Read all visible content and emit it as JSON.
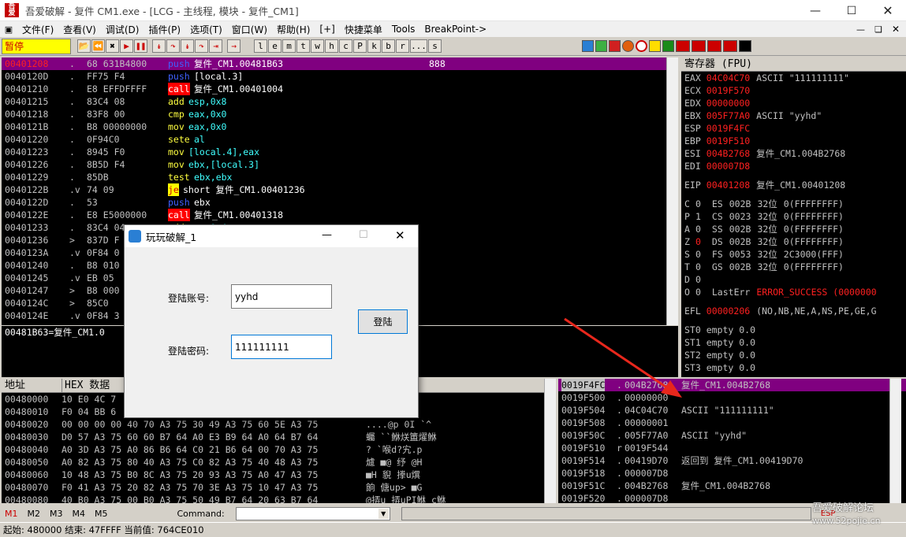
{
  "title": "吾爱破解 - 复件 CM1.exe - [LCG - 主线程, 模块 - 复件_CM1]",
  "menu": [
    "文件(F)",
    "查看(V)",
    "调试(D)",
    "插件(P)",
    "选项(T)",
    "窗口(W)",
    "帮助(H)",
    "[+]",
    "快捷菜单",
    "Tools",
    "BreakPoint->"
  ],
  "state": "暂停",
  "toolbar_letters": [
    "l",
    "e",
    "m",
    "t",
    "w",
    "h",
    "c",
    "P",
    "k",
    "b",
    "r",
    "...",
    "s"
  ],
  "disasm": [
    {
      "addr": "00401208",
      "dot": ".",
      "hex": "68 631B4800",
      "mn": "push",
      "ops": "复件_CM1.00481B63",
      "cmt": "888",
      "sel": true
    },
    {
      "addr": "0040120D",
      "dot": ".",
      "hex": "FF75 F4",
      "mn": "push",
      "ops": "[local.3]"
    },
    {
      "addr": "00401210",
      "dot": ".",
      "hex": "E8 EFFDFFFF",
      "mn": "call",
      "ops": "复件_CM1.00401004"
    },
    {
      "addr": "00401215",
      "dot": ".",
      "hex": "83C4 08",
      "mn": "add",
      "ops": "esp,0x8"
    },
    {
      "addr": "00401218",
      "dot": ".",
      "hex": "83F8 00",
      "mn": "cmp",
      "ops": "eax,0x0"
    },
    {
      "addr": "0040121B",
      "dot": ".",
      "hex": "B8 00000000",
      "mn": "mov",
      "ops": "eax,0x0"
    },
    {
      "addr": "00401220",
      "dot": ".",
      "hex": "0F94C0",
      "mn": "sete",
      "ops": "al"
    },
    {
      "addr": "00401223",
      "dot": ".",
      "hex": "8945 F0",
      "mn": "mov",
      "ops": "[local.4],eax"
    },
    {
      "addr": "00401226",
      "dot": ".",
      "hex": "8B5D F4",
      "mn": "mov",
      "ops": "ebx,[local.3]"
    },
    {
      "addr": "00401229",
      "dot": ".",
      "hex": "85DB",
      "mn": "test",
      "ops": "ebx,ebx"
    },
    {
      "addr": "0040122B",
      "dot": ".v",
      "hex": "74 09",
      "mn": "je",
      "ops": "short 复件_CM1.00401236"
    },
    {
      "addr": "0040122D",
      "dot": ".",
      "hex": "53",
      "mn": "push",
      "ops": "ebx"
    },
    {
      "addr": "0040122E",
      "dot": ".",
      "hex": "E8 E5000000",
      "mn": "call",
      "ops": "复件_CM1.00401318"
    },
    {
      "addr": "00401233",
      "dot": ".",
      "hex": "83C4 04",
      "mn": "add",
      "ops": "esp,0x4"
    },
    {
      "addr": "00401236",
      "dot": ">",
      "hex": "837D F",
      "mn": "",
      "ops": ""
    },
    {
      "addr": "0040123A",
      "dot": ".v",
      "hex": "0F84 0",
      "mn": "",
      "ops": ""
    },
    {
      "addr": "00401240",
      "dot": ".",
      "hex": "B8 010",
      "mn": "",
      "ops": ""
    },
    {
      "addr": "00401245",
      "dot": ".v",
      "hex": "EB 05",
      "mn": "",
      "ops": ""
    },
    {
      "addr": "00401247",
      "dot": ">",
      "hex": "B8 000",
      "mn": "",
      "ops": ""
    },
    {
      "addr": "0040124C",
      "dot": ">",
      "hex": "85C0",
      "mn": "",
      "ops": ""
    },
    {
      "addr": "0040124E",
      "dot": ".v",
      "hex": "0F84 3",
      "mn": "",
      "ops": ""
    }
  ],
  "info_line": "00481B63=复件_CM1.0",
  "registers_title": "寄存器 (FPU)",
  "registers": [
    {
      "n": "EAX",
      "v": "04C04C70",
      "c": "ASCII \"111111111\""
    },
    {
      "n": "ECX",
      "v": "0019F570",
      "c": ""
    },
    {
      "n": "EDX",
      "v": "00000000",
      "c": ""
    },
    {
      "n": "EBX",
      "v": "005F77A0",
      "c": "ASCII \"yyhd\""
    },
    {
      "n": "ESP",
      "v": "0019F4FC",
      "c": ""
    },
    {
      "n": "EBP",
      "v": "0019F510",
      "c": ""
    },
    {
      "n": "ESI",
      "v": "004B2768",
      "c": "复件_CM1.004B2768"
    },
    {
      "n": "EDI",
      "v": "000007D8",
      "c": ""
    }
  ],
  "eip": {
    "n": "EIP",
    "v": "00401208",
    "c": "复件_CM1.00401208"
  },
  "flags": [
    {
      "f": "C",
      "b": "0",
      "seg": "ES",
      "sv": "002B",
      "bits": "32位",
      "rng": "0(FFFFFFFF)"
    },
    {
      "f": "P",
      "b": "1",
      "seg": "CS",
      "sv": "0023",
      "bits": "32位",
      "rng": "0(FFFFFFFF)"
    },
    {
      "f": "A",
      "b": "0",
      "seg": "SS",
      "sv": "002B",
      "bits": "32位",
      "rng": "0(FFFFFFFF)"
    },
    {
      "f": "Z",
      "b": "0",
      "seg": "DS",
      "sv": "002B",
      "bits": "32位",
      "rng": "0(FFFFFFFF)"
    },
    {
      "f": "S",
      "b": "0",
      "seg": "FS",
      "sv": "0053",
      "bits": "32位",
      "rng": "2C3000(FFF)"
    },
    {
      "f": "T",
      "b": "0",
      "seg": "GS",
      "sv": "002B",
      "bits": "32位",
      "rng": "0(FFFFFFFF)"
    },
    {
      "f": "D",
      "b": "0",
      "seg": "",
      "sv": "",
      "bits": "",
      "rng": ""
    },
    {
      "f": "O",
      "b": "0",
      "seg": "LastErr",
      "sv": "ERROR_SUCCESS (0000000",
      "bits": "",
      "rng": ""
    }
  ],
  "efl": {
    "n": "EFL",
    "v": "00000206",
    "c": "(NO,NB,NE,A,NS,PE,GE,G"
  },
  "fpu": [
    "ST0 empty 0.0",
    "ST1 empty 0.0",
    "ST2 empty 0.0",
    "ST3 empty 0.0"
  ],
  "dump_header": {
    "addr": "地址",
    "hex": "HEX 数据"
  },
  "dump": [
    {
      "a": "00480000",
      "h": "10 E0 4C 7",
      "t": "歘?Lv"
    },
    {
      "a": "00480010",
      "h": "F0 04 BB 6",
      "t": "p@■:p"
    },
    {
      "a": "00480020",
      "h": "00 00 00 00 40 70 A3 75 30 49 A3 75 60 5E A3 75",
      "t": "....@p  0I   `^"
    },
    {
      "a": "00480030",
      "h": "D0 57 A3 75 60 60 B7 64 A0 E3 B9 64 A0 64 B7 64",
      "t": "蠾  ``鮴烪簠燿鮴"
    },
    {
      "a": "00480040",
      "h": "A0 3D A3 75 A0 86 B6 64 C0 21 B6 64 00 70 A3 75",
      "t": "?  `喉d?宄.p"
    },
    {
      "a": "00480050",
      "h": "A0 82 A3 75 80 40 A3 75 C0 82 A3 75 40 48 A3 75",
      "t": "爈  ■@  纾  @H"
    },
    {
      "a": "00480060",
      "h": "10 48 A3 75 B0 8C A3 75 20 93 A3 75 A0 47 A3 75",
      "t": "■H  貎   搼u熼"
    },
    {
      "a": "00480070",
      "h": "F0 41 A3 75 20 82 A3 75 70 3E A3 75 10 47 A3 75",
      "t": "餉    傏up>  ■G"
    },
    {
      "a": "00480080",
      "h": "40 B0 A3 75 00 B0 A3 75 50 49 B7 64 20 63 B7 64",
      "t": "@挵u 挵uPI鮴 c鮴"
    }
  ],
  "stack": [
    {
      "a": "0019F4FC",
      "dot": ".",
      "v": "004B2768",
      "c": "复件_CM1.004B2768",
      "sel": true
    },
    {
      "a": "0019F500",
      "dot": ".",
      "v": "00000000",
      "c": ""
    },
    {
      "a": "0019F504",
      "dot": ".",
      "v": "04C04C70",
      "c": "ASCII \"111111111\""
    },
    {
      "a": "0019F508",
      "dot": ".",
      "v": "00000001",
      "c": ""
    },
    {
      "a": "0019F50C",
      "dot": ".",
      "v": "005F77A0",
      "c": "ASCII \"yyhd\""
    },
    {
      "a": "0019F510",
      "dot": "r",
      "v": "0019F544",
      "c": ""
    },
    {
      "a": "0019F514",
      "dot": ".",
      "v": "00419D70",
      "c": "返回到 复件_CM1.00419D70"
    },
    {
      "a": "0019F518",
      "dot": ".",
      "v": "000007D8",
      "c": ""
    },
    {
      "a": "0019F51C",
      "dot": ".",
      "v": "004B2768",
      "c": "复件_CM1.004B2768"
    },
    {
      "a": "0019F520",
      "dot": ".",
      "v": "000007D8",
      "c": ""
    }
  ],
  "cmd_labels": [
    "M1",
    "M2",
    "M3",
    "M4",
    "M5"
  ],
  "cmd_label": "Command:",
  "status": "起始: 480000 结束: 47FFFF 当前值: 764CE010",
  "esp_label": "ESP",
  "watermark1": "吾爱破解论坛",
  "watermark2": "www.52pojie.cn",
  "dialog": {
    "title": "玩玩破解_1",
    "account_label": "登陆账号:",
    "account_value": "yyhd",
    "password_label": "登陆密码:",
    "password_value": "111111111",
    "login_button": "登陆"
  },
  "colors": {
    "red": "#ff2020",
    "purple": "#800080",
    "arrow": "#e8271c"
  }
}
